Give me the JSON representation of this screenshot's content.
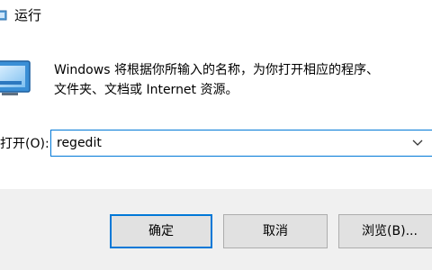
{
  "window": {
    "title": "运行",
    "icon": "run-dialog-icon"
  },
  "content": {
    "description_line1": "Windows 将根据你所输入的名称，为你打开相应的程序、",
    "description_line2": "文件夹、文档或 Internet 资源。",
    "open_label": "打开(O):",
    "open_value": "regedit"
  },
  "buttons": {
    "ok_label": "确定",
    "cancel_label": "取消",
    "browse_label": "浏览(B)..."
  },
  "colors": {
    "accent": "#0078d7",
    "button_bar": "#f0f0f0",
    "button_face": "#e1e1e1"
  }
}
